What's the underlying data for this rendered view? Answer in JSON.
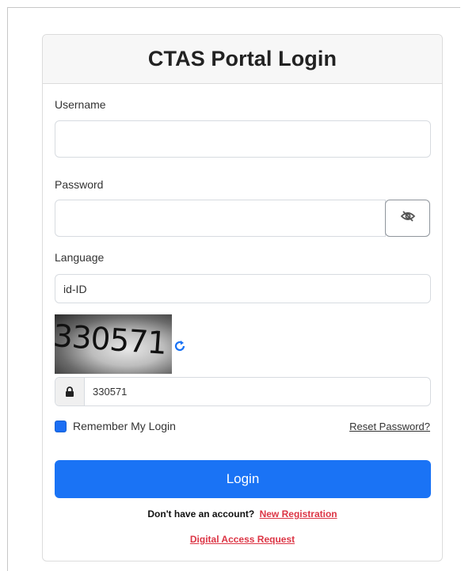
{
  "login": {
    "title": "CTAS Portal Login",
    "username_label": "Username",
    "username_value": "",
    "password_label": "Password",
    "password_value": "",
    "language_label": "Language",
    "language_value": "id-ID",
    "captcha_image_text": "330571",
    "captcha_value": "330571",
    "remember_label": "Remember My Login",
    "remember_checked": true,
    "reset_link": "Reset Password?",
    "login_button": "Login",
    "no_account_text": "Don't have an account?",
    "new_registration_link": "New Registration",
    "digital_access_link": "Digital Access Request"
  },
  "colors": {
    "primary": "#1a73f5",
    "link_red": "#dc3545",
    "header_bg": "#f7f7f7"
  },
  "icons": {
    "password_toggle": "eye-slash-icon",
    "captcha_refresh": "refresh-icon",
    "captcha_lock": "lock-icon"
  }
}
